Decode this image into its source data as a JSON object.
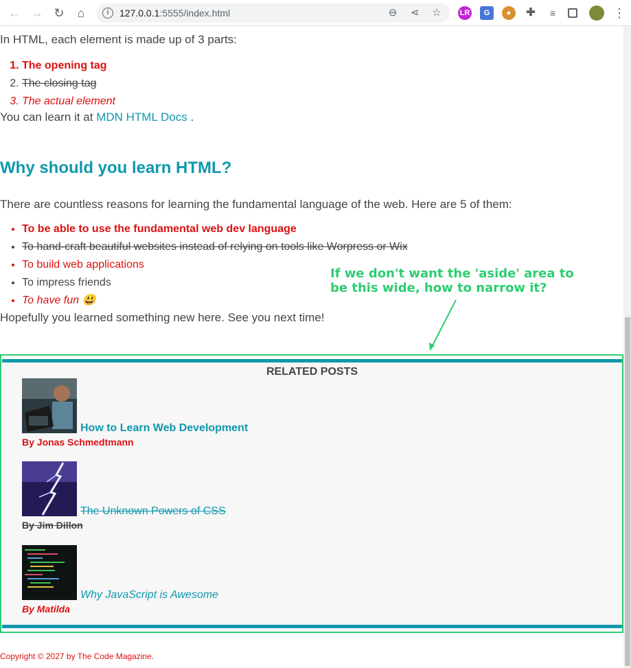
{
  "browser": {
    "url_host": "127.0.0.1",
    "url_rest": ":5555/index.html",
    "icons": [
      "back-icon",
      "forward-icon",
      "reload-icon",
      "home-icon",
      "info-icon",
      "zoom-icon",
      "share-icon",
      "star-icon"
    ]
  },
  "intro": "In HTML, each element is made up of 3 parts:",
  "parts": [
    "The opening tag",
    "The closing tag",
    "The actual element"
  ],
  "learn": {
    "prefix": "You can learn it at ",
    "link": "MDN HTML Docs",
    "suffix": " ."
  },
  "heading": "Why should you learn HTML?",
  "reasons_intro": "There are countless reasons for learning the fundamental language of the web. Here are 5 of them:",
  "reasons": [
    "To be able to use the fundamental web dev language",
    "To hand-craft beautiful websites instead of relying on tools like Worpress or Wix",
    "To build web applications",
    "To impress friends",
    "To have fun 😃"
  ],
  "outro": "Hopefully you learned something new here. See you next time!",
  "annotation": "If we don't want the 'aside' area to\nbe this wide, how to narrow it?",
  "aside": {
    "heading": "RELATED POSTS",
    "posts": [
      {
        "title": "How to Learn Web Development",
        "author": "By Jonas Schmedtmann"
      },
      {
        "title": "The Unknown Powers of CSS",
        "author": "By Jim Dillon"
      },
      {
        "title": "Why JavaScript is Awesome",
        "author": "By Matilda"
      }
    ]
  },
  "footer": "Copyright © 2027 by The Code Magazine.",
  "colors": {
    "accent": "#1098ad",
    "red": "#dd1111",
    "annotation": "#2ecc71"
  }
}
